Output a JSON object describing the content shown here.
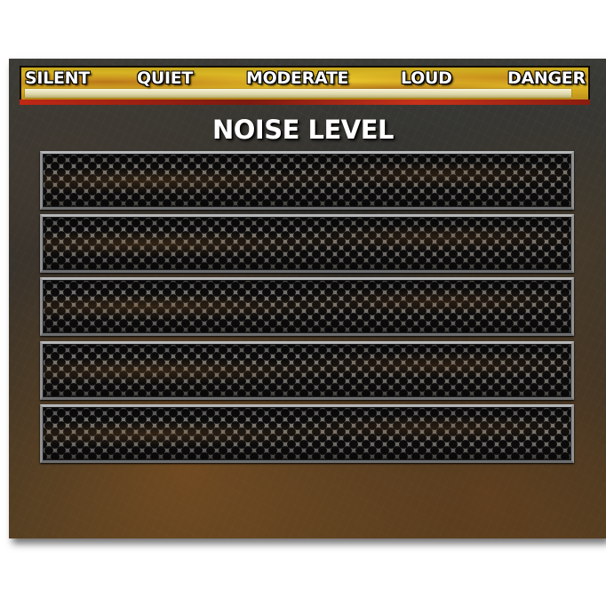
{
  "meter": {
    "labels": [
      "SILENT",
      "QUIET",
      "MODERATE",
      "LOUD",
      "DANGER"
    ],
    "level": 0.98,
    "colors": {
      "fill": "#e8c42a",
      "track": "#f6f3d8",
      "danger": "#c02814"
    }
  },
  "panel": {
    "title": "NOISE LEVEL",
    "slots": [
      {
        "name": "grille-1"
      },
      {
        "name": "grille-2"
      },
      {
        "name": "grille-3"
      },
      {
        "name": "grille-4"
      },
      {
        "name": "grille-5"
      }
    ]
  }
}
